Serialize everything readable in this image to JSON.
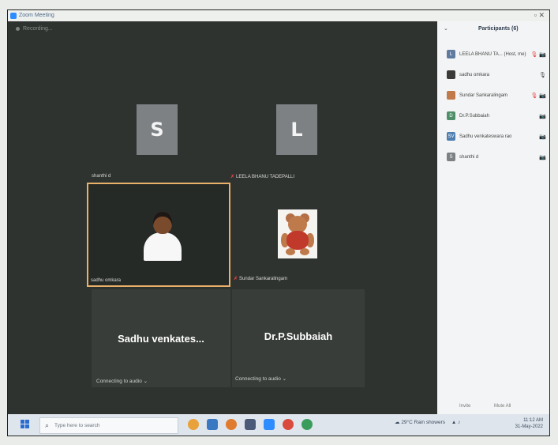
{
  "window": {
    "title": "Zoom Meeting",
    "controls": "▫  ✕"
  },
  "meeting": {
    "recording_label": "Recording...",
    "tiles": [
      {
        "initial": "S",
        "label": "shanthi d"
      },
      {
        "initial": "L",
        "label": "LEELA BHANU TADEPALLI"
      }
    ],
    "video_tiles": [
      {
        "name": "sadhu omkara"
      },
      {
        "name": "Sundar Sankaralingam"
      }
    ],
    "name_tiles": [
      {
        "name": "Sadhu  venkates...",
        "status": "Connecting to audio  ⌄"
      },
      {
        "name": "Dr.P.Subbaiah",
        "status": "Connecting to audio  ⌄"
      }
    ]
  },
  "participants": {
    "title": "Participants (6)",
    "items": [
      {
        "initial": "L",
        "name": "LEELA BHANU TA... (Host, me)",
        "icons": "🎙 📷"
      },
      {
        "initial": "",
        "name": "sadhu omkara",
        "icons": "🎙"
      },
      {
        "initial": "",
        "name": "Sundar Sankaralingam",
        "icons": "🎙 📷"
      },
      {
        "initial": "D",
        "name": "Dr.P.Subbaiah",
        "icons": "📷"
      },
      {
        "initial": "SV",
        "name": "Sadhu venkateswara rao",
        "icons": "📷"
      },
      {
        "initial": "S",
        "name": "shanthi d",
        "icons": "📷"
      }
    ],
    "invite_label": "Invite",
    "mute_all_label": "Mute All"
  },
  "taskbar": {
    "search_placeholder": "Type here to search",
    "weather": "29°C  Rain showers",
    "time": "11:12 AM",
    "date": "31-May-2022"
  },
  "colors": {
    "accent_blue": "#2d8cff",
    "active_speaker_border": "#e9b06a",
    "muted_red": "#e04040"
  }
}
